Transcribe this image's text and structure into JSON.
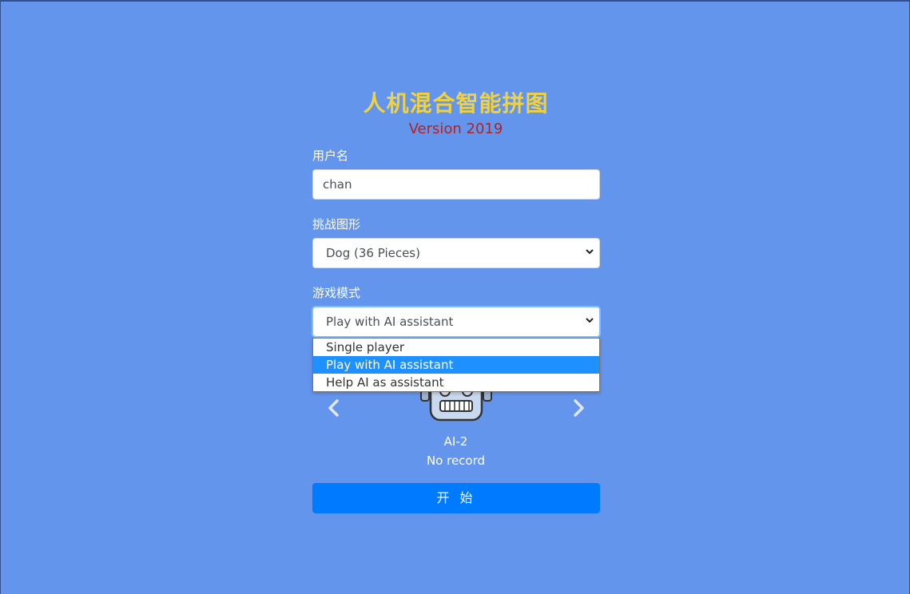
{
  "header": {
    "title": "人机混合智能拼图",
    "version": "Version 2019"
  },
  "form": {
    "username_label": "用户名",
    "username_value": "chan",
    "shape_label": "挑战图形",
    "shape_value": "Dog (36 Pieces)",
    "mode_label": "游戏模式",
    "mode_value": "Play with AI assistant",
    "mode_options": [
      "Single player",
      "Play with AI assistant",
      "Help AI as assistant"
    ]
  },
  "ai": {
    "name": "AI-2",
    "record": "No record"
  },
  "actions": {
    "start_label": "开 始"
  },
  "icons": {
    "prev": "chevron-left-icon",
    "next": "chevron-right-icon",
    "robot": "robot-avatar-icon",
    "dropdown": "chevron-down-icon"
  },
  "colors": {
    "background": "#6495ED",
    "title": "#f2d23c",
    "version": "#b22222",
    "primary_button": "#007bff",
    "option_highlight": "#1e90ff"
  }
}
